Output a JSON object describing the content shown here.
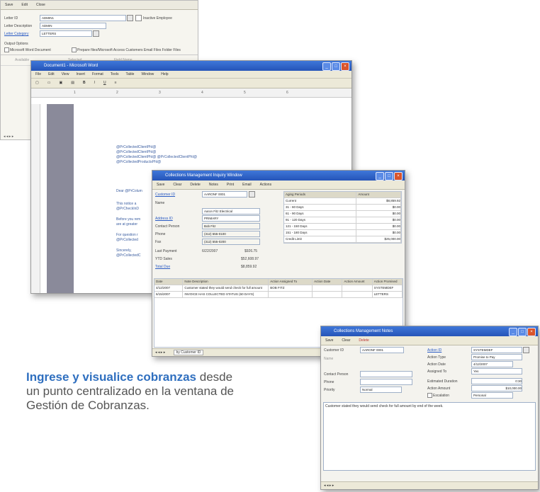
{
  "win1": {
    "menu": [
      "Save",
      "Edit",
      "Close"
    ],
    "rows": [
      {
        "label": "Letter ID",
        "value": "ADMIN1"
      },
      {
        "label": "Letter Description",
        "value": "ADMIN"
      },
      {
        "label": "Letter Category",
        "value": "LETTERS"
      },
      {
        "label": "Output Options",
        "value": ""
      }
    ],
    "checkbox1": "Inactive Employee",
    "checkbox2": "Microsoft Word Document",
    "checkbox3": "Prepare files/Microsoft Access Customers Email Files Folder Files",
    "footer_items": [
      "Available",
      "Selected",
      "Field Name"
    ]
  },
  "word": {
    "title": "Document1 - Microsoft Word",
    "menu": [
      "File",
      "Edit",
      "View",
      "Insert",
      "Format",
      "Tools",
      "Table",
      "Window",
      "Help"
    ],
    "merge_fields": [
      "@PrCollectedClientPhI@",
      "@PrCollectedClientPhI@",
      "@PrCollectedClientPhI@ @PrCollectedClientPhI@",
      "@PrCollectedProductsPhI@"
    ],
    "para1": "Dear @PrColum",
    "para2": "This notice a\n@PrCheckInD",
    "para3": "Before you rem\nare at greater",
    "para4": "For question r\n@PrCollected",
    "para5": "Sincerely,\n@PrCollectedC"
  },
  "collections": {
    "title": "Collections Management Inquiry Window",
    "toolbar": [
      "Save",
      "Clear",
      "Delete",
      "Notes",
      "Print",
      "Email",
      "Actions"
    ],
    "customer_id_label": "Customer ID",
    "customer_id": "AARONF 0001",
    "name_label": "Name",
    "name_value": "Aaron Fitz Electrical",
    "address_label": "Address ID",
    "address_value": "PRIMARY",
    "contact_label": "Contact Person",
    "contact_value": "Bob Fitz",
    "phone_label": "Phone",
    "phone_value": "(312) 555-0100",
    "fax_label": "Fax",
    "fax_value": "(312) 555-0200",
    "last_payment_label": "Last Payment",
    "last_payment_value": "6/22/2007",
    "last_payment_amt": "$926.75",
    "ytd_label": "YTD Sales",
    "ytd_value": "$52,608.97",
    "balance_label": "Total Due",
    "balance_value": "$8,859.92",
    "aging_title": "Aging Periods",
    "aging_rows": [
      {
        "period": "Current",
        "amount": "$8,859.92"
      },
      {
        "period": "31 - 60 Days",
        "amount": "$0.00"
      },
      {
        "period": "61 - 90 Days",
        "amount": "$0.00"
      },
      {
        "period": "91 - 120 Days",
        "amount": "$0.00"
      },
      {
        "period": "121 - 150 Days",
        "amount": "$0.00"
      },
      {
        "period": "151 - 180 Days",
        "amount": "$0.00"
      }
    ],
    "credit_limit_label": "Credit Limit",
    "credit_limit": "$25,000.00",
    "grid_headers": [
      "Date",
      "Note Description",
      "Action Assigned To",
      "Action Date",
      "Action Amount",
      "Action Promised"
    ],
    "grid_rows": [
      [
        "4/12/2007",
        "Customer stated they would send check for full amount",
        "BOB FITZ",
        "",
        "",
        "SYSTEMDEF"
      ],
      [
        "6/15/2007",
        "INVOICE HAS COLLECTED STATUS (60 DAYS)",
        "",
        "",
        "",
        "LETTERS"
      ]
    ],
    "status_field": "by Customer ID"
  },
  "notes": {
    "title": "Collections Management Notes",
    "toolbar": [
      "Save",
      "Clear",
      "Delete"
    ],
    "customer_id_label": "Customer ID",
    "customer_id": "AARONF 0001",
    "name_label": "Name",
    "action_label": "Action ID",
    "action_value": "SYSTEMDEF",
    "action_type_label": "Action Type",
    "action_type": "Promise to Pay",
    "action_date_label": "Action Date",
    "action_date": "4/12/2007",
    "assigned_label": "Assigned To",
    "assigned_value": "Yes",
    "contact_label": "Contact Person",
    "phone_label": "Phone",
    "priority_label": "Priority",
    "priority_value": "Normal",
    "estimated_label": "Estimated Duration",
    "estimated_value": "0:30",
    "action_amount_label": "Action Amount",
    "action_amount": "$10,000.00",
    "escalation_label": "Escalation",
    "escalation_value": "Personal",
    "note_text": "Customer stated they would send check for full amount by end of the week."
  },
  "caption": {
    "bold": "Ingrese y visualice cobranzas",
    "rest": " desde un punto centralizado en la ventana de Gestión de Cobranzas."
  }
}
